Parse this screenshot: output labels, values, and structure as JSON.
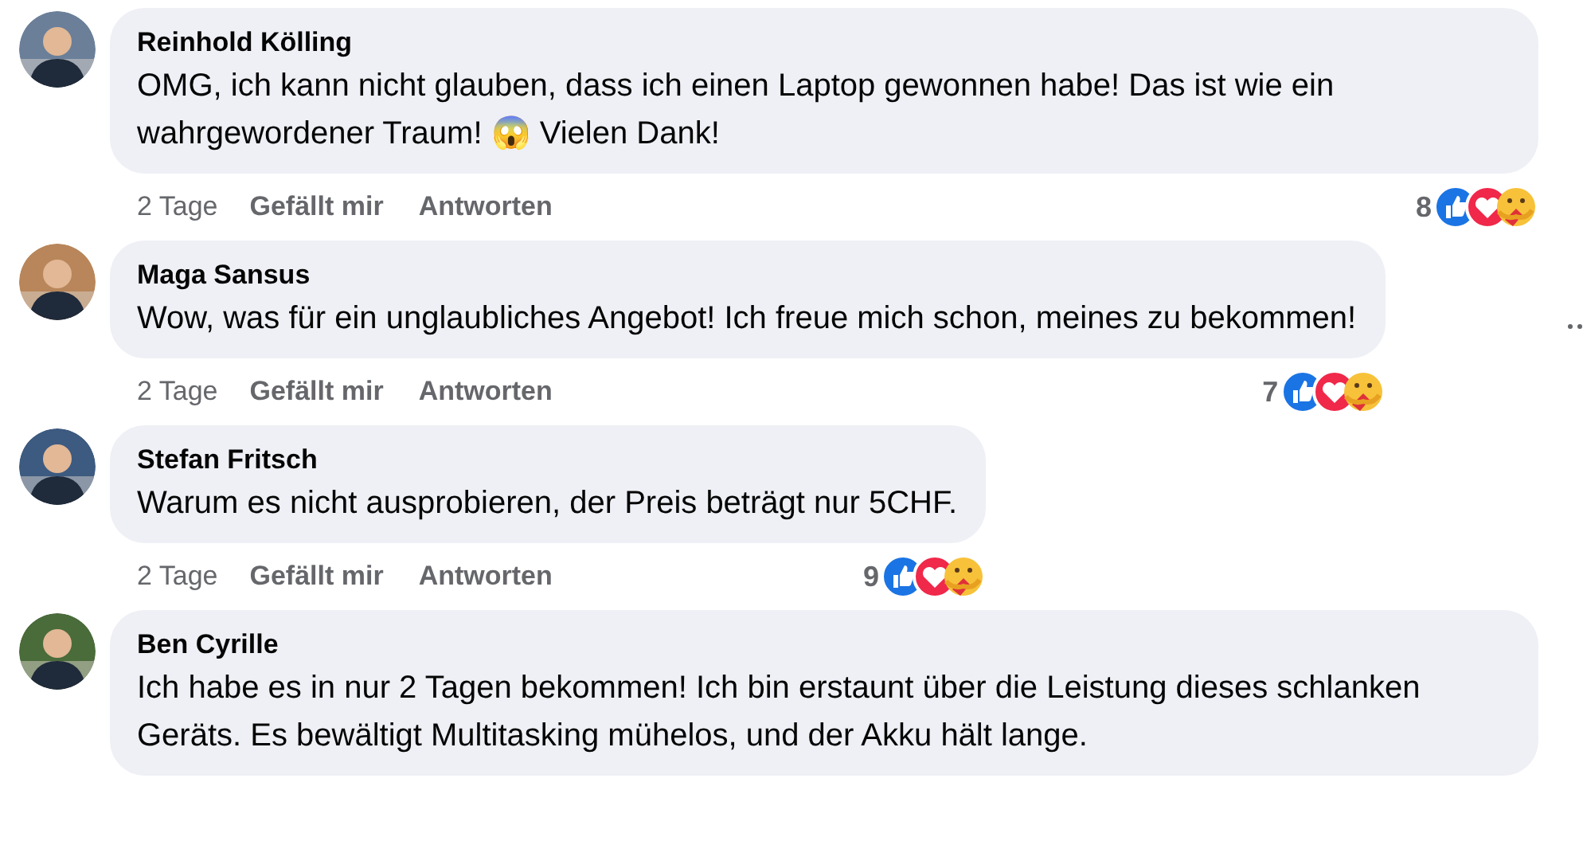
{
  "comments": [
    {
      "author": "Reinhold Kölling",
      "text": "OMG, ich kann nicht glauben, dass ich einen Laptop gewonnen habe! Das ist wie ein wahrgewordener Traum! 😱 Vielen Dank!",
      "time": "2 Tage",
      "like": "Gefällt mir",
      "reply": "Antworten",
      "reactions": "8"
    },
    {
      "author": "Maga Sansus",
      "text": "Wow, was für ein unglaubliches Angebot! Ich freue mich schon, meines zu bekommen!",
      "time": "2 Tage",
      "like": "Gefällt mir",
      "reply": "Antworten",
      "reactions": "7"
    },
    {
      "author": "Stefan Fritsch",
      "text": "Warum es nicht ausprobieren, der Preis beträgt nur 5CHF.",
      "time": "2 Tage",
      "like": "Gefällt mir",
      "reply": "Antworten",
      "reactions": "9"
    },
    {
      "author": "Ben Cyrille",
      "text": "Ich habe es in nur 2 Tagen bekommen! Ich bin erstaunt über die Leistung dieses schlanken Geräts. Es bewältigt Multitasking mühelos, und der Akku hält lange."
    }
  ]
}
